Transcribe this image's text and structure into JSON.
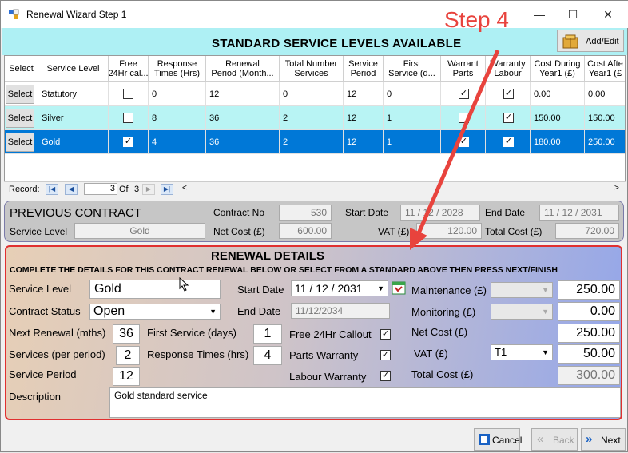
{
  "window": {
    "title": "Renewal Wizard Step 1",
    "min": "—",
    "max": "☐",
    "close": "✕"
  },
  "annotation": "Step 4",
  "header": {
    "heading": "STANDARD SERVICE LEVELS AVAILABLE",
    "add_edit": "Add/Edit"
  },
  "grid": {
    "columns": [
      "Select",
      "Service Level",
      "Free\n24Hr cal...",
      "Response\nTimes (Hrs)",
      "Renewal\nPeriod (Month...",
      "Total Number\nServices",
      "Service\nPeriod",
      "First\nService (d...",
      "Warrant\nParts",
      "Warranty\nLabour",
      "Cost During\nYear1 (£)",
      "Cost Afte\nYear1 (£"
    ],
    "rows": [
      {
        "select": "Select",
        "level": "Statutory",
        "free": false,
        "response": "0",
        "renewal": "12",
        "total": "0",
        "period": "12",
        "first": "0",
        "parts": true,
        "labour": true,
        "cost1": "0.00",
        "cost2": "0.00"
      },
      {
        "select": "Select",
        "level": "Silver",
        "free": false,
        "response": "8",
        "renewal": "36",
        "total": "2",
        "period": "12",
        "first": "1",
        "parts": false,
        "labour": true,
        "cost1": "150.00",
        "cost2": "150.00"
      },
      {
        "select": "Select",
        "level": "Gold",
        "free": true,
        "response": "4",
        "renewal": "36",
        "total": "2",
        "period": "12",
        "first": "1",
        "parts": true,
        "labour": true,
        "cost1": "180.00",
        "cost2": "250.00"
      }
    ]
  },
  "nav": {
    "record_label": "Record:",
    "current": "3",
    "of": "Of",
    "total": "3"
  },
  "previous": {
    "title": "PREVIOUS CONTRACT",
    "contract_no_label": "Contract No",
    "contract_no": "530",
    "start_label": "Start Date",
    "start": "11 / 12 / 2028",
    "end_label": "End Date",
    "end": "11 / 12 / 2031",
    "level_label": "Service Level",
    "level": "Gold",
    "net_label": "Net Cost (£)",
    "net": "600.00",
    "vat_label": "VAT (£)",
    "vat": "120.00",
    "total_label": "Total Cost (£)",
    "total": "720.00"
  },
  "renewal": {
    "title": "RENEWAL DETAILS",
    "instructions": "COMPLETE THE DETAILS FOR THIS CONTRACT RENEWAL BELOW OR SELECT FROM A STANDARD  ABOVE THEN PRESS NEXT/FINISH",
    "level_label": "Service Level",
    "level": "Gold",
    "status_label": "Contract Status",
    "status": "Open",
    "next_label": "Next Renewal (mths)",
    "next": "36",
    "services_label": "Services (per period)",
    "services": "2",
    "period_label": "Service Period",
    "period": "12",
    "first_label": "First Service (days)",
    "first": "1",
    "response_label": "Response Times (hrs)",
    "response": "4",
    "start_label": "Start Date",
    "start": "11 / 12 / 2031",
    "end_label": "End Date",
    "end": "11/12/2034",
    "free_label": "Free 24Hr Callout",
    "parts_label": "Parts Warranty",
    "labour_label": "Labour Warranty",
    "maint_label": "Maintenance (£)",
    "maint": "250.00",
    "monitor_label": "Monitoring (£)",
    "monitor": "0.00",
    "net_label": "Net Cost (£)",
    "net": "250.00",
    "vat_label": "VAT (£)",
    "vat_code": "T1",
    "vat": "50.00",
    "total_label": "Total Cost (£)",
    "total": "300.00",
    "desc_label": "Description",
    "desc": "Gold standard service"
  },
  "buttons": {
    "cancel": "Cancel",
    "back": "Back",
    "next": "Next"
  },
  "colors": {
    "selected_row": "#0078d7",
    "alt_row": "#b8f4f4",
    "cyan": "#aef0f4",
    "annotation": "#e8433d"
  }
}
